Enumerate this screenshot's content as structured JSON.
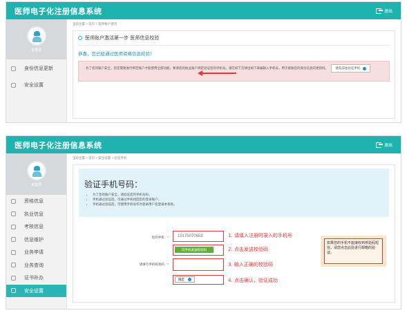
{
  "app_title": "医师电子化注册信息系统",
  "logout_label": "退出",
  "screen1": {
    "username": "未登录",
    "breadcrumb": "当前位置 > 首页 > 医师账户激活",
    "nav": [
      {
        "label": "身份信息更新",
        "icon": "id-card-icon"
      },
      {
        "label": "安全设置",
        "icon": "user-lock-icon"
      }
    ],
    "step_title": "医师账户激活第一步 医师信息校验",
    "congrats": "恭喜，您已经通过医师资格信息校验！",
    "alert_text": "为了您的账户安全，您还需要进行绑定账户才能使用全部功能，要请您的执业账户绑定验证您的手机号。请在如下方弹出如下来编辑入手机号，用于接收您的身份信息的更新码。",
    "verify_button": "请先前往验证手机"
  },
  "screen2": {
    "username": "未登录",
    "breadcrumb": "当前位置 > 首页 > 安全设置 > 验证手机",
    "nav": [
      {
        "label": "资格信息",
        "icon": "doc-icon",
        "active": false
      },
      {
        "label": "执业信息",
        "icon": "user-icon",
        "active": false
      },
      {
        "label": "考核信息",
        "icon": "check-icon",
        "active": false
      },
      {
        "label": "信息维护",
        "icon": "edit-icon",
        "active": false
      },
      {
        "label": "业务申请",
        "icon": "apply-icon",
        "active": false
      },
      {
        "label": "业务查询",
        "icon": "search-icon",
        "active": false
      },
      {
        "label": "证书补办",
        "icon": "cert-icon",
        "active": false
      },
      {
        "label": "安全设置",
        "icon": "lock-icon",
        "active": true
      }
    ],
    "verify_title": "验证手机号码：",
    "tips": [
      "为了您的账户安全，请验证您的手机号码；",
      "手机通过验证后，可通过手机找回您的登录账户；",
      "手机通过验证后，可使用手机号作为登录用户名登录本系统。"
    ],
    "phone_label": "您的手机：*",
    "phone_value": "15175070658",
    "send_button": "向手机发送校验码",
    "code_label": "请填写手机校验码：*",
    "confirm_button": "确定",
    "annotations": [
      "1. 请填入注册时录入的手机号",
      "2. 点击发送校验码",
      "3. 输入正确的校验码",
      "4. 点击确认，验证成功"
    ],
    "help_text": "如果您的手机不能接收到校验码短信，请您点击此处进行邮箱的验证。"
  },
  "colors": {
    "accent": "#1fb3b0",
    "annotation_red": "#e33333",
    "alert_bg": "#f7dfe0",
    "banner_bg": "#e1f2f9"
  }
}
